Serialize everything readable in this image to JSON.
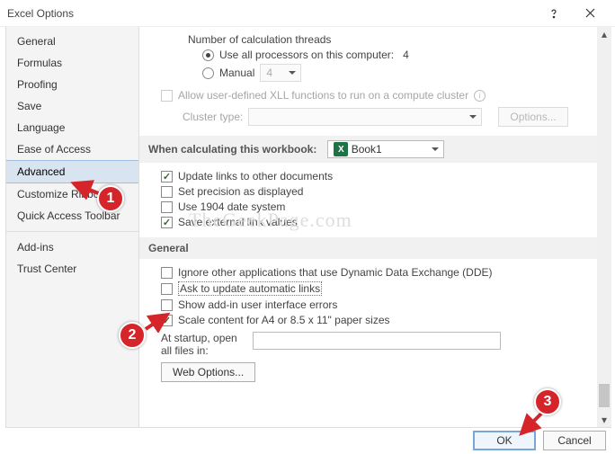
{
  "window": {
    "title": "Excel Options"
  },
  "sidebar": {
    "items": [
      "General",
      "Formulas",
      "Proofing",
      "Save",
      "Language",
      "Ease of Access",
      "Advanced",
      "Customize Ribbon",
      "Quick Access Toolbar",
      "Add-ins",
      "Trust Center"
    ],
    "selected_index": 6
  },
  "content": {
    "threads_label": "Number of calculation threads",
    "use_all_label": "Use all processors on this computer:",
    "use_all_value": "4",
    "manual_label": "Manual",
    "manual_value": "4",
    "xll_label": "Allow user-defined XLL functions to run on a compute cluster",
    "cluster_type_label": "Cluster type:",
    "cluster_options_btn": "Options...",
    "section_workbook": "When calculating this workbook:",
    "workbook_name": "Book1",
    "opt_update_links": "Update links to other documents",
    "opt_precision": "Set precision as displayed",
    "opt_1904": "Use 1904 date system",
    "opt_external": "Save external link values",
    "section_general": "General",
    "opt_dde": "Ignore other applications that use Dynamic Data Exchange (DDE)",
    "opt_ask_update": "Ask to update automatic links",
    "opt_addin_errors": "Show add-in user interface errors",
    "opt_scale_a4": "Scale content for A4 or 8.5 x 11\" paper sizes",
    "startup_label": "At startup, open all files in:",
    "web_options_btn": "Web Options...",
    "underline": {
      "threads": 10,
      "use_all": 4,
      "manual": 0,
      "xll": 5,
      "cluster_type": 8,
      "update_links": 22,
      "precision": 4,
      "1904": 9,
      "external": 7,
      "dde": 7,
      "ask_update": 7,
      "addin_err": 12,
      "scale": 18,
      "startup": 12
    }
  },
  "footer": {
    "ok": "OK",
    "cancel": "Cancel"
  },
  "annotations": {
    "c1": "1",
    "c2": "2",
    "c3": "3"
  },
  "watermark": "TheGeekPage.com"
}
